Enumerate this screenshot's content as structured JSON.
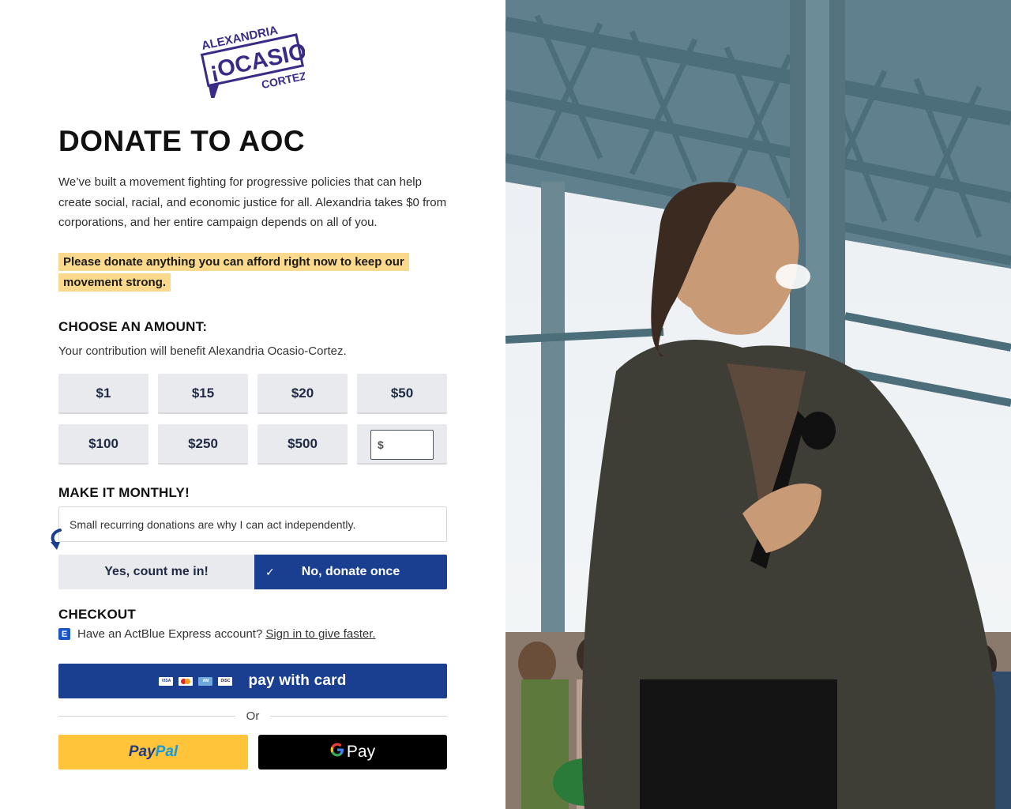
{
  "logo": {
    "top_text": "ALEXANDRIA",
    "main_text": "¡OCASIO!",
    "bottom_text": "CORTEZ"
  },
  "title": "DONATE TO AOC",
  "intro": "We’ve built a movement fighting for progressive policies that can help create social, racial, and economic justice for all. Alexandria takes $0 from corporations, and her entire campaign depends on all of you.",
  "highlight": "Please donate anything you can afford right now to keep our movement strong.",
  "amount_section": {
    "heading": "CHOOSE AN AMOUNT:",
    "subtext": "Your contribution will benefit Alexandria Ocasio-Cortez.",
    "amounts": [
      "$1",
      "$15",
      "$20",
      "$50",
      "$100",
      "$250",
      "$500"
    ],
    "other_prefix": "$",
    "other_value": ""
  },
  "monthly": {
    "heading": "MAKE IT MONTHLY!",
    "message": "Small recurring donations are why I can act independently.",
    "yes_label": "Yes, count me in!",
    "no_label": "No, donate once",
    "check": "✓"
  },
  "checkout": {
    "heading": "CHECKOUT",
    "express_icon": "E",
    "express_text": "Have an ActBlue Express account?",
    "express_link": "Sign in to give faster.",
    "card_label": "pay with card",
    "card_icons": {
      "visa": "VISA",
      "amex": "AM",
      "discover": "DISC"
    },
    "or_label": "Or",
    "paypal_pay": "Pay",
    "paypal_pal": "Pal",
    "gpay_g": "G",
    "gpay_pay": "Pay"
  },
  "colors": {
    "primary_blue": "#1a3f91",
    "highlight_yellow": "#fbd98c",
    "button_gray": "#e8eaed",
    "paypal_yellow": "#ffc439",
    "logo_purple": "#3b2a86"
  },
  "icons": [
    "logo-icon",
    "curved-arrow-icon",
    "checkmark-icon",
    "actblue-express-icon",
    "visa-icon",
    "mastercard-icon",
    "amex-icon",
    "discover-icon",
    "paypal-logo",
    "google-g-icon"
  ]
}
